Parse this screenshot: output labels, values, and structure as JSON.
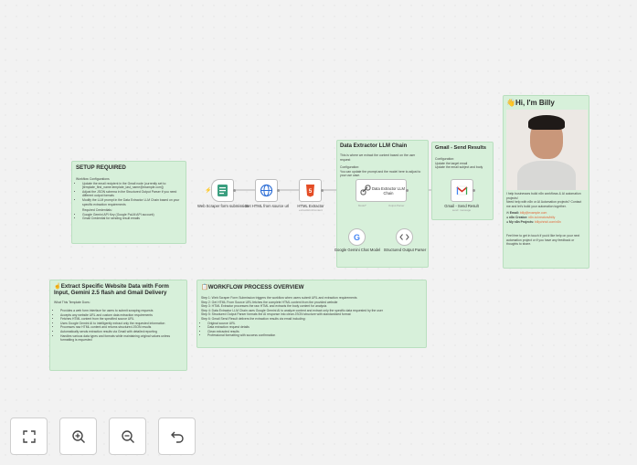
{
  "setup": {
    "title": "SETUP REQUIRED",
    "section1": "Workflow Configurations",
    "items1": [
      "Update the email recipient in the Gmail node (currently set to: [template_first_name.template_last_name@example.com])",
      "Adjust the JSON schema in the Structured Output Parser if you need different output formats",
      "Modify the LLM prompt in the Data Extractor LLM Chain based on your specific extraction requirements"
    ],
    "section2": "Required Credentials:",
    "items2": [
      "Google Gemini API Key (Google PaLM API account)",
      "Gmail Credential for sending result emails"
    ]
  },
  "extract": {
    "title": "Extract Specific Website Data with Form Input, Gemini 2.5 flash and Gmail Delivery",
    "intro": "What This Template Does:",
    "items": [
      "Provides a web form interface for users to submit scraping requests",
      "Accepts any website URL and custom data extraction requirements",
      "Fetches HTML content from the specified source URL",
      "Uses Google Gemini AI to intelligently extract only the requested information",
      "Processes raw HTML content and returns structured JSON results",
      "Automatically sends extraction results via Gmail with detailed reporting",
      "Handles various data types and formats while maintaining original values unless formatting is requested"
    ]
  },
  "overview": {
    "title": "WORKFLOW PROCESS OVERVIEW",
    "steps": [
      "Step 1: Web Scraper Form Submission triggers the workflow when users submit URL and extraction requirements",
      "Step 2: Get HTML From Source URL fetches the complete HTML content from the provided website",
      "Step 3: HTML Extractor processes the raw HTML and extracts the body content for analysis",
      "Step 4: Data Extractor LLM Chain uses Google Gemini AI to analyze content and extract only the specific data requested by the user",
      "Step 5: Structured Output Parser formats the AI response into clean JSON structure with standardized format",
      "Step 6: Gmail Send Result delivers the extraction results via email including:"
    ],
    "bullets": [
      "Original source URL",
      "Data extraction request details",
      "Clean extracted results",
      "Professional formatting with success confirmation"
    ]
  },
  "llm": {
    "title": "Data Extractor LLM Chain",
    "desc": "This is where we extract the content based on the user request",
    "config_head": "Configuration:",
    "config": "You can update the prompt and the model here to adjust to your use case."
  },
  "gmail_note": {
    "title": "Gmail - Send Results",
    "config_head": "Configuration:",
    "lines": [
      "Update the target email",
      "Update the email subject and body"
    ]
  },
  "billy": {
    "title": "Hi, I'm Billy",
    "p1": "I help businesses build n8n workflows & AI automation projects!",
    "p2": "Need help with n8n or AI Automation projects? Contact me and let's build your automation together.",
    "email_label": "Email:",
    "email": "billy@example.com",
    "creator_label": "n8n Creator:",
    "creator": "n8n.io/creators/billy",
    "projects_label": "My n8n Projects:",
    "projects": "billychristi.com/n8n",
    "footer": "Feel free to get in touch if you'd like help on your next automation project or if you have any feedback or thoughts to share."
  },
  "nodes": {
    "form": {
      "label": "Web Scraper form submission"
    },
    "http": {
      "label": "Get HTML from source url"
    },
    "html": {
      "label": "HTML Extractor",
      "sub": "extractHtmlContent"
    },
    "llm": {
      "label": "Data Extractor LLM Chain"
    },
    "gmail": {
      "label": "Gmail - Send Result",
      "sub": "send: message"
    },
    "gemini": {
      "label": "Google Gemini Chat Model"
    },
    "parser": {
      "label": "Structured Output Parser"
    }
  },
  "connectors": {
    "model": "Model*",
    "output_parser": "Output Parser"
  },
  "controls": {
    "fit": "fit-view-icon",
    "zoom_in": "zoom-in-icon",
    "zoom_out": "zoom-out-icon",
    "undo": "undo-icon"
  },
  "colors": {
    "sticky": "#d7f0da",
    "accent": "#e0683c",
    "gmail_red": "#d93025",
    "gemini_blue": "#4285f4"
  }
}
